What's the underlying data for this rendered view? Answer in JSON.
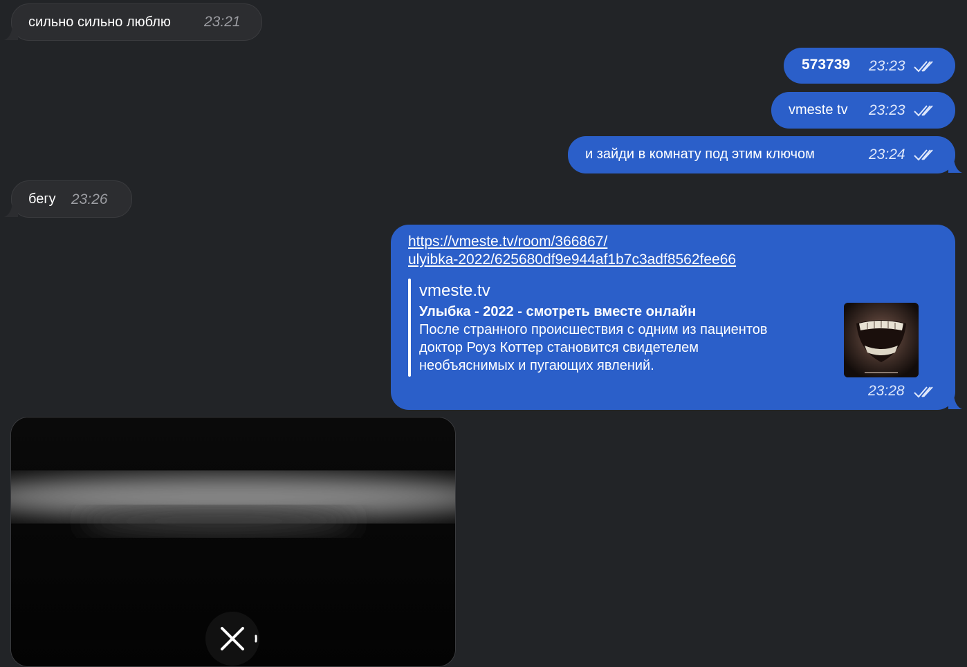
{
  "messages": [
    {
      "id": "m1",
      "side": "incoming",
      "text": "сильно сильно люблю",
      "time": "23:21"
    },
    {
      "id": "m2",
      "side": "outgoing",
      "text": "573739",
      "time": "23:23",
      "read": true
    },
    {
      "id": "m3",
      "side": "outgoing",
      "text": "vmeste tv",
      "time": "23:23",
      "read": true
    },
    {
      "id": "m4",
      "side": "outgoing",
      "text": "и зайди в комнату под этим ключом",
      "time": "23:24",
      "read": true
    },
    {
      "id": "m5",
      "side": "incoming",
      "text": "бегу",
      "time": "23:26"
    },
    {
      "id": "m6",
      "side": "outgoing",
      "time": "23:28",
      "read": true,
      "link_lines": [
        "https://vmeste.tv/room/366867/",
        "ulyibka-2022/625680df9e944af1b7c3adf8562fee66"
      ],
      "preview": {
        "site": "vmeste.tv",
        "title": "Улыбка - 2022 - смотреть вместе онлайн",
        "description_lines": [
          "После странного происшествия с одним из пациентов",
          "доктор Роуз Коттер становится свидетелем",
          "необъяснимых и пугающих явлений."
        ],
        "thumbnail_icon": "movie-poster-image"
      }
    },
    {
      "id": "m7",
      "side": "incoming",
      "type": "video",
      "cancel_icon": "close-icon"
    }
  ],
  "colors": {
    "background": "#222427",
    "incoming_bubble": "#2c2d30",
    "outgoing_bubble": "#2b5fc9",
    "timestamp_incoming": "#9b9ca1"
  }
}
